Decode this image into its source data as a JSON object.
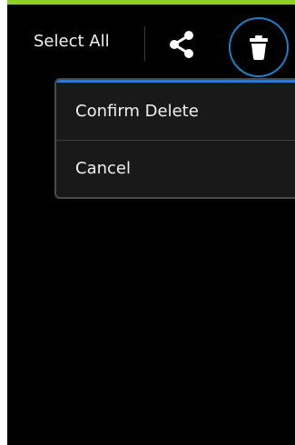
{
  "colors": {
    "status_strip": "#8fcf2a",
    "screen_background": "#000000",
    "popup_background": "#191919",
    "popup_accent": "#2f79c9",
    "highlight_ring": "#1e7fc6",
    "text": "#f0f0f0"
  },
  "action_bar": {
    "select_all_label": "Select All",
    "share_icon": "share-icon",
    "delete_icon": "trash-icon"
  },
  "popup_menu": {
    "items": [
      {
        "label": "Confirm Delete"
      },
      {
        "label": "Cancel"
      }
    ]
  }
}
